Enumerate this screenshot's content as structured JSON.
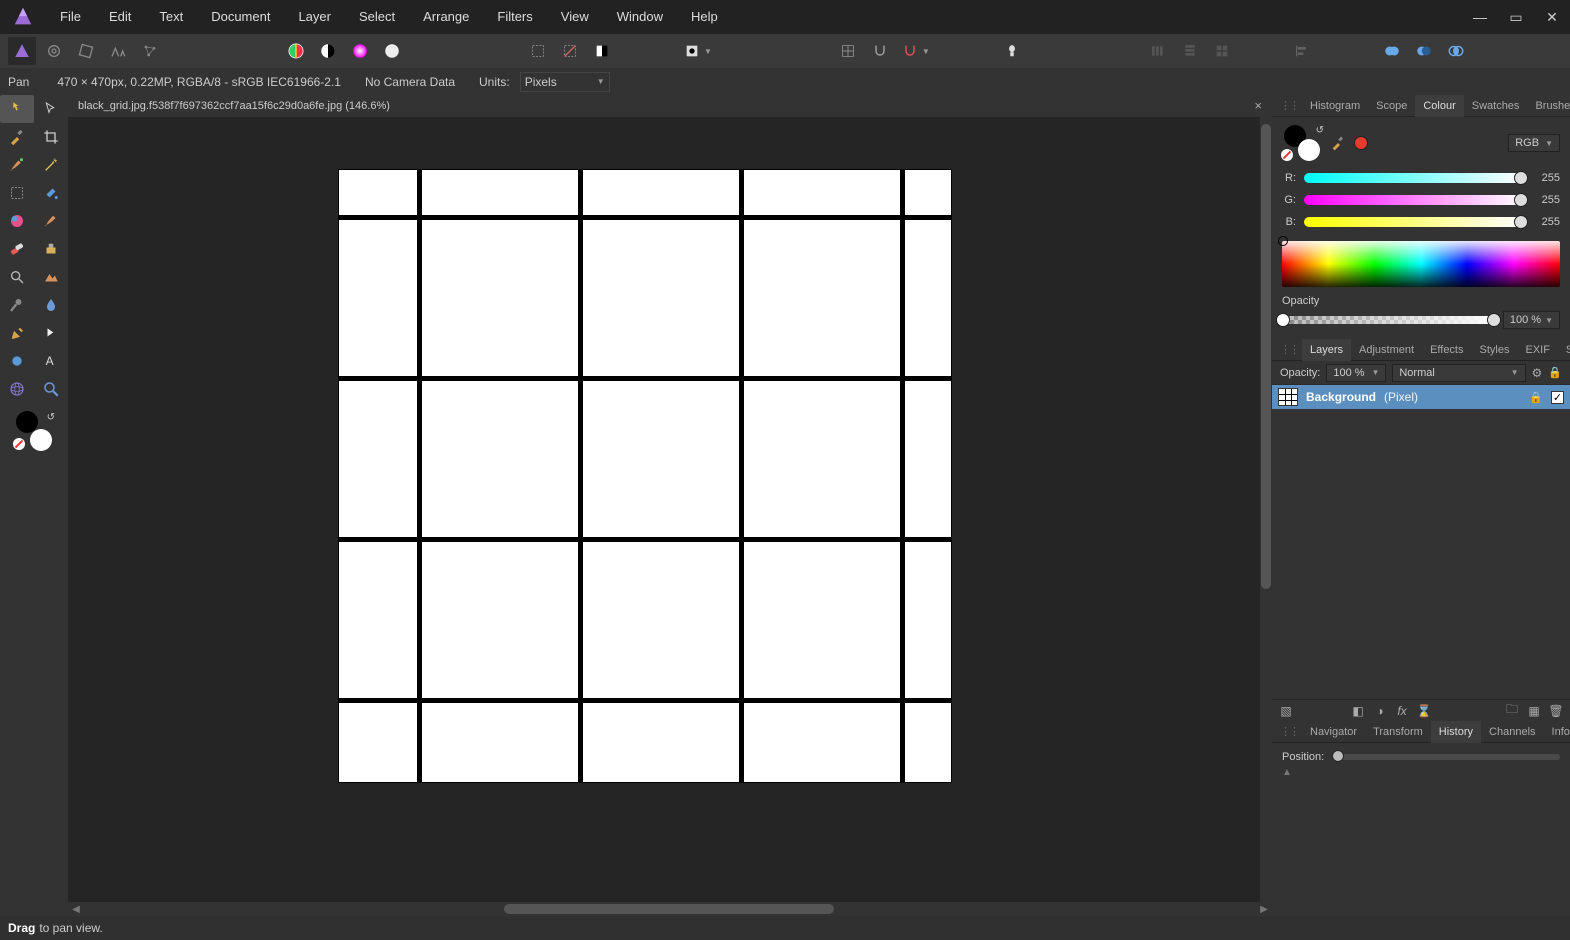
{
  "menu": {
    "items": [
      "File",
      "Edit",
      "Text",
      "Document",
      "Layer",
      "Select",
      "Arrange",
      "Filters",
      "View",
      "Window",
      "Help"
    ]
  },
  "context": {
    "tool": "Pan",
    "info": "470 × 470px, 0.22MP, RGBA/8 - sRGB IEC61966-2.1",
    "camera": "No Camera Data",
    "units_label": "Units:",
    "units_value": "Pixels"
  },
  "doc": {
    "tab": "black_grid.jpg.f538f7f697362ccf7aa15f6c29d0a6fe.jpg (146.6%)"
  },
  "panels": {
    "top_tabs": [
      "Histogram",
      "Scope",
      "Colour",
      "Swatches",
      "Brushes"
    ],
    "top_active": "Colour",
    "mid_tabs": [
      "Layers",
      "Adjustment",
      "Effects",
      "Styles",
      "EXIF",
      "Stock"
    ],
    "mid_active": "Layers",
    "bot_tabs": [
      "Navigator",
      "Transform",
      "History",
      "Channels",
      "Info"
    ],
    "bot_active": "History"
  },
  "colour": {
    "mode": "RGB",
    "r": 255,
    "g": 255,
    "b": 255,
    "labels": {
      "r": "R:",
      "g": "G:",
      "b": "B:"
    },
    "opacity_label": "Opacity",
    "opacity": "100 %"
  },
  "layers": {
    "opacity_label": "Opacity:",
    "opacity": "100 %",
    "blend": "Normal",
    "items": [
      {
        "name": "Background",
        "type": "(Pixel)",
        "visible": true,
        "locked": true
      }
    ]
  },
  "history": {
    "position_label": "Position:"
  },
  "status": {
    "hint_bold": "Drag",
    "hint_rest": "to pan view."
  }
}
